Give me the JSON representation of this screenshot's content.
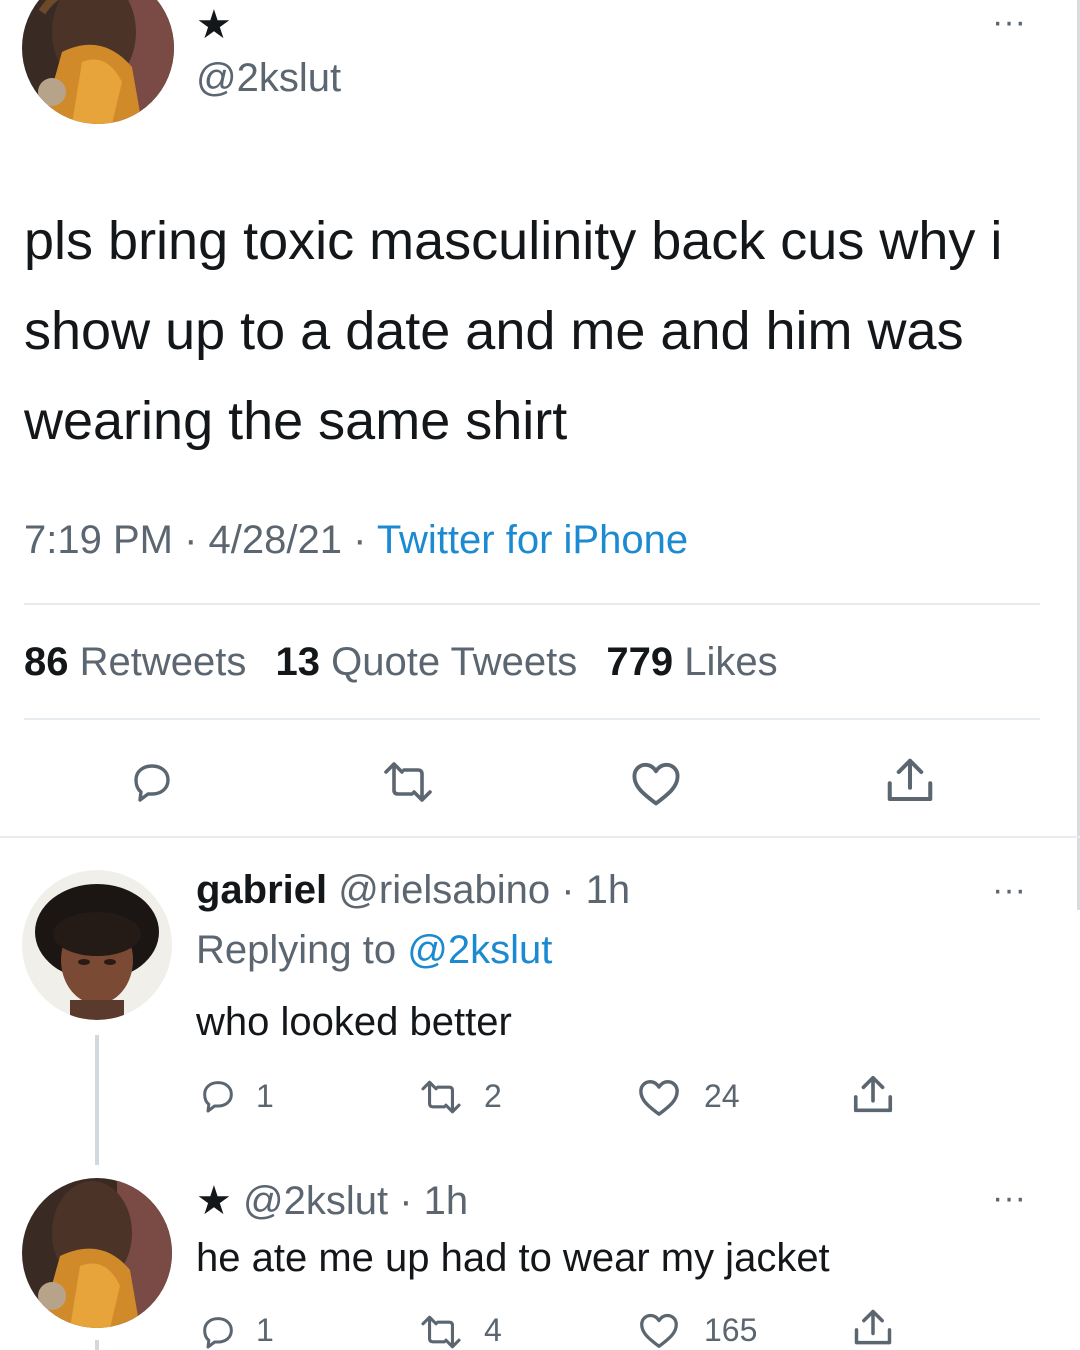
{
  "main_tweet": {
    "star": "★",
    "handle": "@2kslut",
    "text": "pls bring toxic masculinity back cus why i show up to a date and me and him was wearing the same shirt",
    "time": "7:19 PM",
    "sep1": " · ",
    "date": "4/28/21",
    "sep2": " · ",
    "source": "Twitter for iPhone",
    "more": "···",
    "stats": {
      "retweets_count": "86",
      "retweets_label": "Retweets",
      "quotes_count": "13",
      "quotes_label": "Quote Tweets",
      "likes_count": "779",
      "likes_label": "Likes"
    },
    "actions": [
      "reply-icon",
      "retweet-icon",
      "like-icon",
      "share-icon"
    ]
  },
  "replies": [
    {
      "name": "gabriel",
      "handle": "@rielsabino",
      "time": "· 1h",
      "replying_prefix": "Replying to ",
      "replying_to": "@2kslut",
      "text": "who looked better",
      "more": "···",
      "reply_count": "1",
      "retweet_count": "2",
      "like_count": "24"
    },
    {
      "star": "★",
      "handle": "@2kslut",
      "time": "· 1h",
      "text": "he ate me up had to wear my jacket",
      "more": "···",
      "reply_count": "1",
      "retweet_count": "4",
      "like_count": "165"
    }
  ],
  "colors": {
    "text": "#14171a",
    "secondary": "#5b6670",
    "link": "#1b8ad1",
    "divider": "#e6ecf0"
  }
}
